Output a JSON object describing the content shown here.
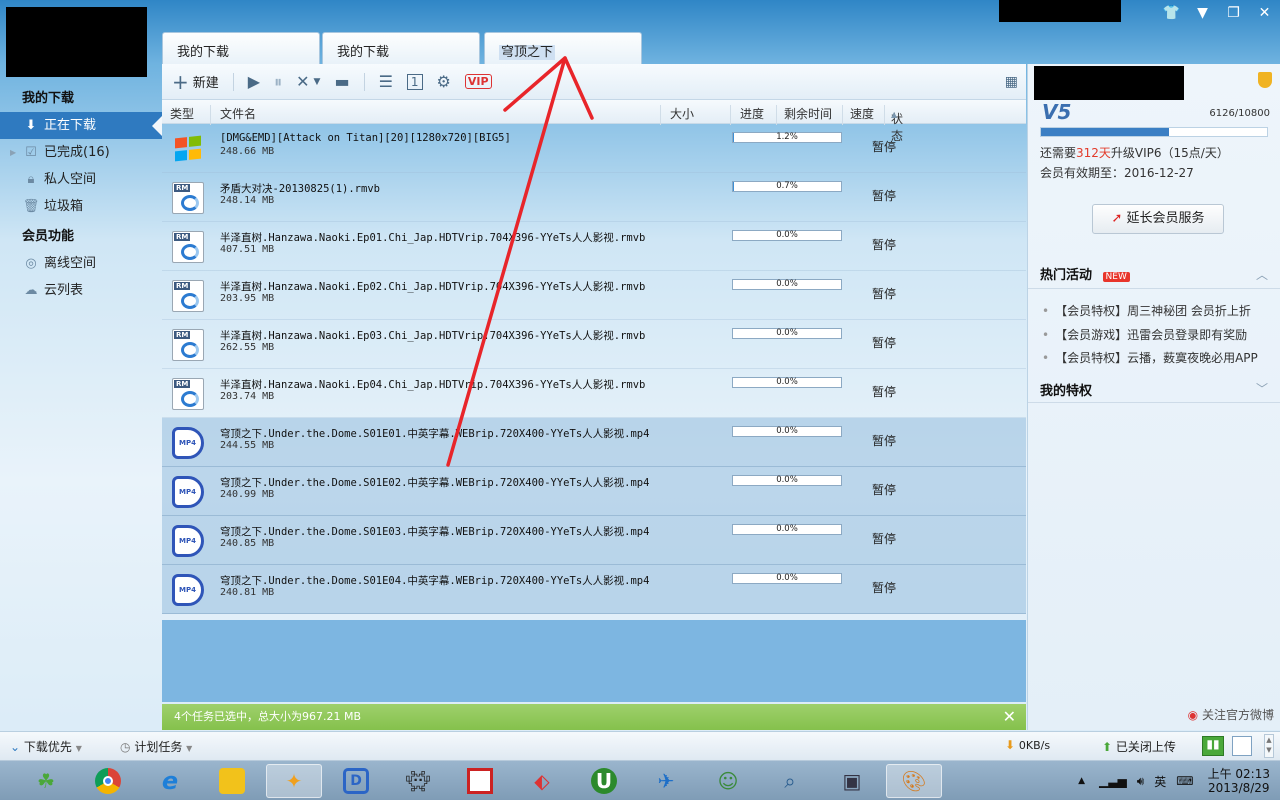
{
  "window_controls": [
    "👕",
    "▼",
    "❐",
    "✕"
  ],
  "tabs": [
    {
      "label": "我的下载"
    },
    {
      "label": "我的下载"
    },
    {
      "label": "穹顶之下"
    }
  ],
  "toolbar": {
    "new_label": "新建"
  },
  "nav": {
    "section1": "我的下载",
    "downloading": "正在下载",
    "completed": "已完成(16)",
    "private": "私人空间",
    "trash": "垃圾箱",
    "section2": "会员功能",
    "offline": "离线空间",
    "cloud": "云列表"
  },
  "columns": {
    "type": "类型",
    "name": "文件名",
    "size": "大小",
    "progress": "进度",
    "remaining": "剩余时间",
    "speed": "速度",
    "status": "状态"
  },
  "rows": [
    {
      "name": "[DMG&EMD][Attack on Titan][20][1280x720][BIG5]",
      "size": "248.66 MB",
      "progress": "1.2%",
      "progress_value": 1.2,
      "status": "暂停",
      "icon": "windows-file-icon",
      "selected": false
    },
    {
      "name": "矛盾大对决-20130825(1).rmvb",
      "size": "248.14 MB",
      "progress": "0.7%",
      "progress_value": 0.7,
      "status": "暂停",
      "icon": "rm-file-icon",
      "selected": false
    },
    {
      "name": "半泽直树.Hanzawa.Naoki.Ep01.Chi_Jap.HDTVrip.704X396-YYeTs人人影视.rmvb",
      "size": "407.51 MB",
      "progress": "0.0%",
      "progress_value": 0,
      "status": "暂停",
      "icon": "rm-file-icon",
      "selected": false
    },
    {
      "name": "半泽直树.Hanzawa.Naoki.Ep02.Chi_Jap.HDTVrip.704X396-YYeTs人人影视.rmvb",
      "size": "203.95 MB",
      "progress": "0.0%",
      "progress_value": 0,
      "status": "暂停",
      "icon": "rm-file-icon",
      "selected": false
    },
    {
      "name": "半泽直树.Hanzawa.Naoki.Ep03.Chi_Jap.HDTVrip.704X396-YYeTs人人影视.rmvb",
      "size": "262.55 MB",
      "progress": "0.0%",
      "progress_value": 0,
      "status": "暂停",
      "icon": "rm-file-icon",
      "selected": false
    },
    {
      "name": "半泽直树.Hanzawa.Naoki.Ep04.Chi_Jap.HDTVrip.704X396-YYeTs人人影视.rmvb",
      "size": "203.74 MB",
      "progress": "0.0%",
      "progress_value": 0,
      "status": "暂停",
      "icon": "rm-file-icon",
      "selected": false
    },
    {
      "name": "穹顶之下.Under.the.Dome.S01E01.中英字幕.WEBrip.720X400-YYeTs人人影视.mp4",
      "size": "244.55 MB",
      "progress": "0.0%",
      "progress_value": 0,
      "status": "暂停",
      "icon": "mp4-file-icon",
      "selected": true
    },
    {
      "name": "穹顶之下.Under.the.Dome.S01E02.中英字幕.WEBrip.720X400-YYeTs人人影视.mp4",
      "size": "240.99 MB",
      "progress": "0.0%",
      "progress_value": 0,
      "status": "暂停",
      "icon": "mp4-file-icon",
      "selected": true
    },
    {
      "name": "穹顶之下.Under.the.Dome.S01E03.中英字幕.WEBrip.720X400-YYeTs人人影视.mp4",
      "size": "240.85 MB",
      "progress": "0.0%",
      "progress_value": 0,
      "status": "暂停",
      "icon": "mp4-file-icon",
      "selected": true
    },
    {
      "name": "穹顶之下.Under.the.Dome.S01E04.中英字幕.WEBrip.720X400-YYeTs人人影视.mp4",
      "size": "240.81 MB",
      "progress": "0.0%",
      "progress_value": 0,
      "status": "暂停",
      "icon": "mp4-file-icon",
      "selected": true
    }
  ],
  "selection_bar": {
    "text": "4个任务已选中，总大小为967.21 MB"
  },
  "bottom": {
    "priority": "下载优先",
    "schedule": "计划任务",
    "down_speed": "0KB/s",
    "upload": "已关闭上传"
  },
  "member": {
    "level": "V5",
    "points": "6126/10800",
    "points_fraction": 0.567,
    "need_prefix": "还需要",
    "need_days": "312天",
    "need_suffix": "升级VIP6（15点/天）",
    "expiry": "会员有效期至：2016-12-27",
    "renew_label": "延长会员服务",
    "hot_title": "热门活动",
    "new_badge": "NEW",
    "hot_items": [
      "【会员特权】周三神秘团 会员折上折",
      "【会员游戏】迅雷会员登录即有奖励",
      "【会员特权】云播，薮寞夜晚必用APP"
    ],
    "privilege_title": "我的特权",
    "weibo": "关注官方微博"
  },
  "taskbar": {
    "ime": "英",
    "time": "上午 02:13",
    "date": "2013/8/29"
  },
  "colors": {
    "accent": "#2f7ac0",
    "selection_bar": "#8dc657",
    "annotation_arrow": "#e8252a",
    "highlight_days": "#e23b2b"
  }
}
